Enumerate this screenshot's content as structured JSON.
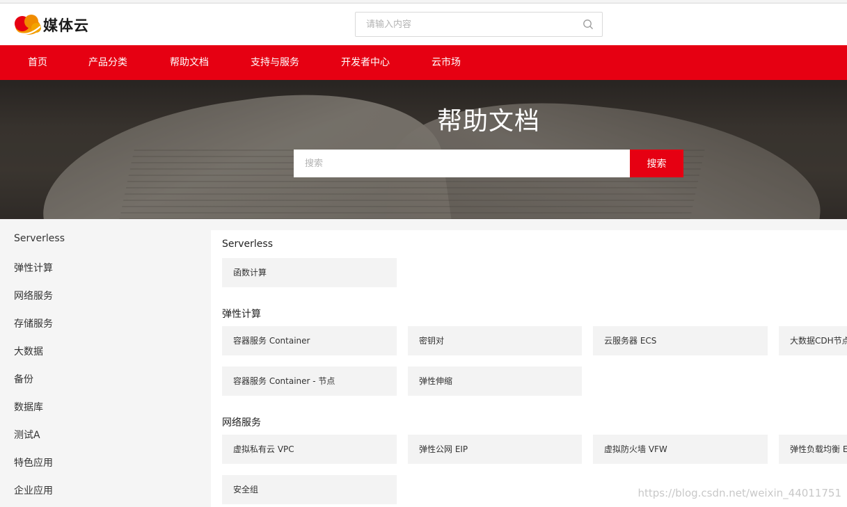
{
  "header": {
    "logo_text": "媒体云",
    "search_placeholder": "请输入内容"
  },
  "nav": {
    "items": [
      "首页",
      "产品分类",
      "帮助文档",
      "支持与服务",
      "开发者中心",
      "云市场"
    ]
  },
  "banner": {
    "title": "帮助文档",
    "search_placeholder": "搜索",
    "search_button": "搜索"
  },
  "sidebar": {
    "items": [
      "Serverless",
      "弹性计算",
      "网络服务",
      "存储服务",
      "大数据",
      "备份",
      "数据库",
      "测试A",
      "特色应用",
      "企业应用"
    ]
  },
  "sections": [
    {
      "title": "Serverless",
      "cards": [
        "函数计算"
      ]
    },
    {
      "title": "弹性计算",
      "cards": [
        "容器服务 Container",
        "密钥对",
        "云服务器 ECS",
        "大数据CDH节点",
        "容器服务 Container - 节点",
        "弹性伸缩"
      ]
    },
    {
      "title": "网络服务",
      "cards": [
        "虚拟私有云 VPC",
        "弹性公网 EIP",
        "虚拟防火墙 VFW",
        "弹性负载均衡 ELB",
        "安全组"
      ]
    }
  ],
  "watermark": "https://blog.csdn.net/weixin_44011751",
  "colors": {
    "brand_red": "#e60012",
    "sidebar_bg": "#f5f5f5",
    "card_bg": "#f3f3f3"
  }
}
